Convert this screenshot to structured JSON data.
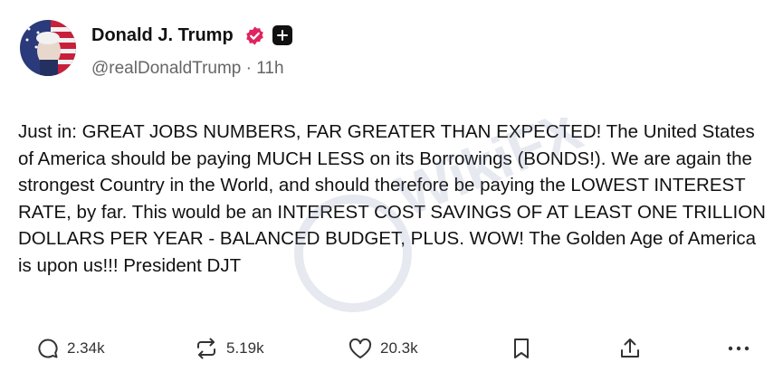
{
  "author": {
    "name": "Donald J. Trump",
    "handle": "@realDonaldTrump",
    "separator": "·",
    "time_ago": "11h",
    "verified_icon": "verified-badge-icon",
    "follow_icon": "plus-icon",
    "badge_color": "#e0245e"
  },
  "post": {
    "text": "Just in: GREAT JOBS NUMBERS, FAR GREATER THAN EXPECTED! The United States of America should be paying MUCH LESS on its Borrowings (BONDS!). We are again the strongest Country in the World, and should therefore be paying the LOWEST INTEREST RATE, by far. This would be an INTEREST COST SAVINGS OF AT LEAST ONE TRILLION DOLLARS PER YEAR - BALANCED BUDGET, PLUS. WOW! The Golden Age of America is upon us!!! President DJT"
  },
  "actions": {
    "reply": {
      "icon": "reply-icon",
      "count": "2.34k"
    },
    "repost": {
      "icon": "repost-icon",
      "count": "5.19k"
    },
    "like": {
      "icon": "heart-icon",
      "count": "20.3k"
    },
    "bookmark": {
      "icon": "bookmark-icon"
    },
    "share": {
      "icon": "share-icon"
    },
    "more": {
      "icon": "more-icon"
    }
  },
  "watermark": {
    "text": "WikiFX"
  }
}
